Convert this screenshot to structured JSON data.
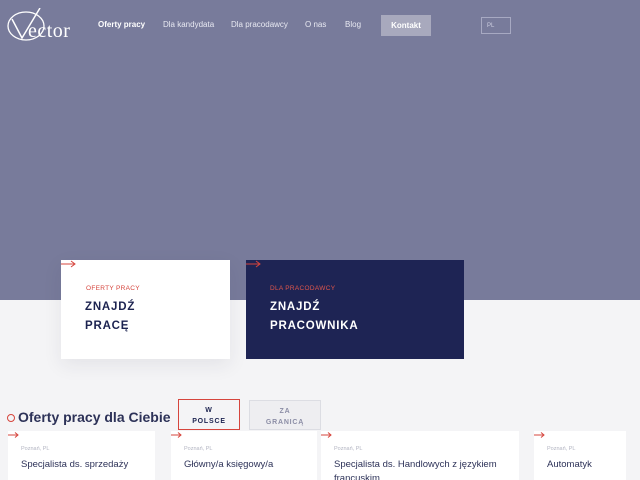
{
  "brand": {
    "logo_text": "ector"
  },
  "nav": {
    "items": [
      {
        "label": "Oferty pracy"
      },
      {
        "label": "Dla kandydata"
      },
      {
        "label": "Dla pracodawcy"
      },
      {
        "label": "O nas"
      },
      {
        "label": "Blog"
      }
    ],
    "active_index": 0,
    "contact_label": "Kontakt",
    "language": "PL"
  },
  "cards": [
    {
      "label": "OFERTY PRACY",
      "title_line1": "ZNAJDŹ",
      "title_line2": "PRACĘ"
    },
    {
      "label": "DLA PRACODAWCY",
      "title_line1": "ZNAJDŹ",
      "title_line2": "PRACOWNIKA"
    }
  ],
  "jobs_section": {
    "title": "Oferty pracy dla Ciebie",
    "tabs": [
      {
        "line1": "W",
        "line2": "POLSCE",
        "selected": true
      },
      {
        "line1": "ZA",
        "line2": "GRANICĄ",
        "selected": false
      }
    ],
    "jobs": [
      {
        "location": "Poznań, PL",
        "title": "Specjalista ds. sprzedaży"
      },
      {
        "location": "Poznań, PL",
        "title": "Główny/a księgowy/a"
      },
      {
        "location": "Poznań, PL",
        "title": "Specjalista ds. Handlowych z językiem francuskim"
      },
      {
        "location": "Poznań, PL",
        "title": "Automatyk"
      }
    ]
  },
  "colors": {
    "hero": "#787b9b",
    "navy": "#1e2454",
    "accent_red": "#d6453d",
    "page_bg": "#f4f4f6"
  },
  "icons": [
    "vector-logo-icon",
    "arrow-right-icon"
  ]
}
